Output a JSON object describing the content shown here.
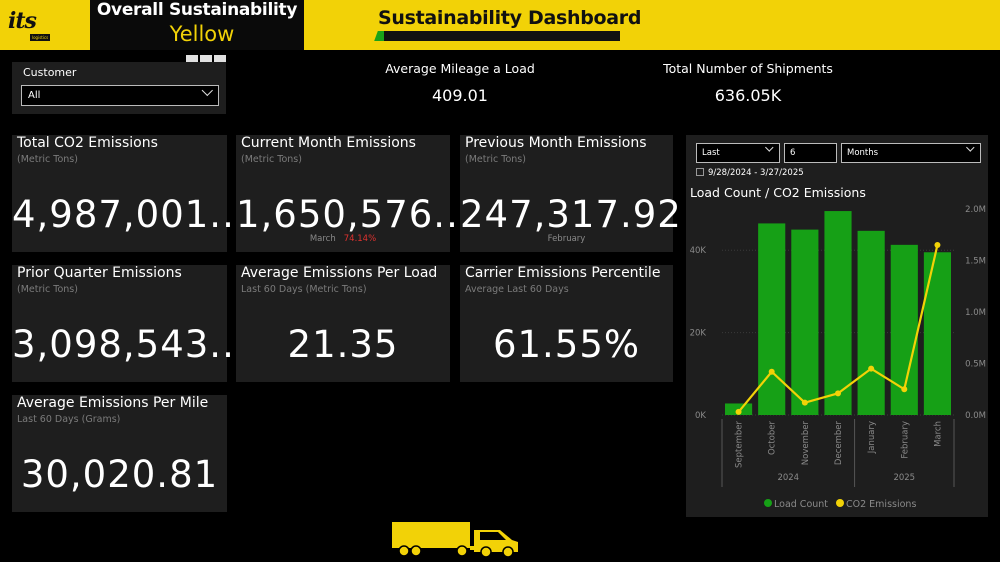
{
  "header": {
    "logo_text": "its",
    "logo_sub": "logistics",
    "overall_title": "Overall Sustainability",
    "overall_value": "Yellow",
    "dashboard_title": "Sustainability Dashboard"
  },
  "colors": {
    "brand_yellow": "#f2d207",
    "panel": "#1e1e1e",
    "bar_green": "#16a016",
    "line_yellow": "#f2d207",
    "negative_red": "#e0322f"
  },
  "customer_filter": {
    "label": "Customer",
    "value": "All"
  },
  "kpis_top": {
    "mileage_label": "Average Mileage a Load",
    "mileage_value": "409.01",
    "shipments_label": "Total Number of Shipments",
    "shipments_value": "636.05K"
  },
  "cards": {
    "total_co2": {
      "title": "Total CO2 Emissions",
      "subtitle": "(Metric Tons)",
      "value": "4,987,001..."
    },
    "current_month": {
      "title": "Current Month Emissions",
      "subtitle": "(Metric Tons)",
      "value": "1,650,576...",
      "month": "March",
      "change": "74.14%"
    },
    "previous_month": {
      "title": "Previous Month Emissions",
      "subtitle": "(Metric Tons)",
      "value": "247,317.92",
      "month": "February"
    },
    "prior_quarter": {
      "title": "Prior Quarter Emissions",
      "subtitle": "(Metric Tons)",
      "value": "3,098,543..."
    },
    "avg_per_load": {
      "title": "Average Emissions Per Load",
      "subtitle": "Last 60 Days (Metric Tons)",
      "value": "21.35"
    },
    "carrier_percentile": {
      "title": "Carrier Emissions Percentile",
      "subtitle": "Average Last 60 Days",
      "value": "61.55%"
    },
    "avg_per_mile": {
      "title": "Average Emissions Per Mile",
      "subtitle": "Last 60 Days (Grams)",
      "value": "30,020.81"
    }
  },
  "date_filter": {
    "mode": "Last",
    "count": "6",
    "unit": "Months",
    "range": "9/28/2024 - 3/27/2025"
  },
  "chart_data": {
    "type": "bar",
    "title": "Load Count / CO2 Emissions",
    "categories": [
      "September",
      "October",
      "November",
      "December",
      "January",
      "February",
      "March"
    ],
    "year_groups": [
      {
        "label": "2024",
        "start": 0,
        "end": 3
      },
      {
        "label": "2025",
        "start": 4,
        "end": 6
      }
    ],
    "series": [
      {
        "name": "Load Count",
        "type": "bar",
        "axis": "left",
        "color": "#16a016",
        "values": [
          2800,
          46500,
          45000,
          49500,
          44700,
          41300,
          39500
        ]
      },
      {
        "name": "CO2 Emissions",
        "type": "line",
        "axis": "right",
        "color": "#f2d207",
        "values": [
          30000,
          420000,
          120000,
          210000,
          450000,
          250000,
          1650000
        ]
      }
    ],
    "y_left": {
      "ticks": [
        "0K",
        "20K",
        "40K"
      ],
      "ylim": [
        0,
        50000
      ]
    },
    "y_right": {
      "ticks": [
        "0.0M",
        "0.5M",
        "1.0M",
        "1.5M",
        "2.0M"
      ],
      "ylim": [
        0,
        2000000
      ]
    },
    "legend_position": "bottom",
    "grid": true
  }
}
